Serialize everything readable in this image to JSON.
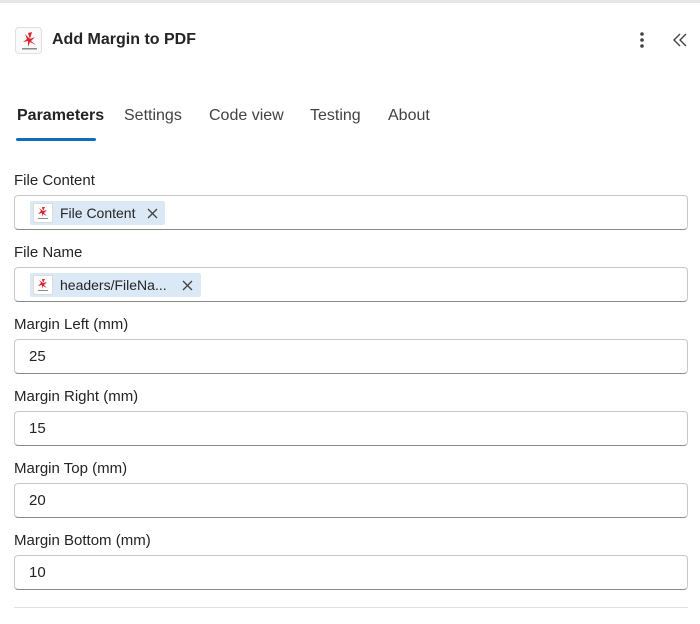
{
  "header": {
    "title": "Add Margin to PDF",
    "logo_icon": "pdf4me-logo-icon",
    "more_icon": "more-vertical-icon",
    "collapse_icon": "double-chevron-left-icon"
  },
  "tabs": [
    {
      "label": "Parameters",
      "active": true
    },
    {
      "label": "Settings",
      "active": false
    },
    {
      "label": "Code view",
      "active": false
    },
    {
      "label": "Testing",
      "active": false
    },
    {
      "label": "About",
      "active": false
    }
  ],
  "fields": {
    "file_content": {
      "label": "File Content",
      "token": "File Content"
    },
    "file_name": {
      "label": "File Name",
      "token": "headers/FileNa..."
    },
    "margin_left": {
      "label": "Margin Left (mm)",
      "value": "25"
    },
    "margin_right": {
      "label": "Margin Right (mm)",
      "value": "15"
    },
    "margin_top": {
      "label": "Margin Top (mm)",
      "value": "20"
    },
    "margin_bottom": {
      "label": "Margin Bottom (mm)",
      "value": "10"
    }
  },
  "colors": {
    "accent": "#0f6cbd",
    "token_bg": "#dbe9f7",
    "logo_red": "#d7262f"
  }
}
